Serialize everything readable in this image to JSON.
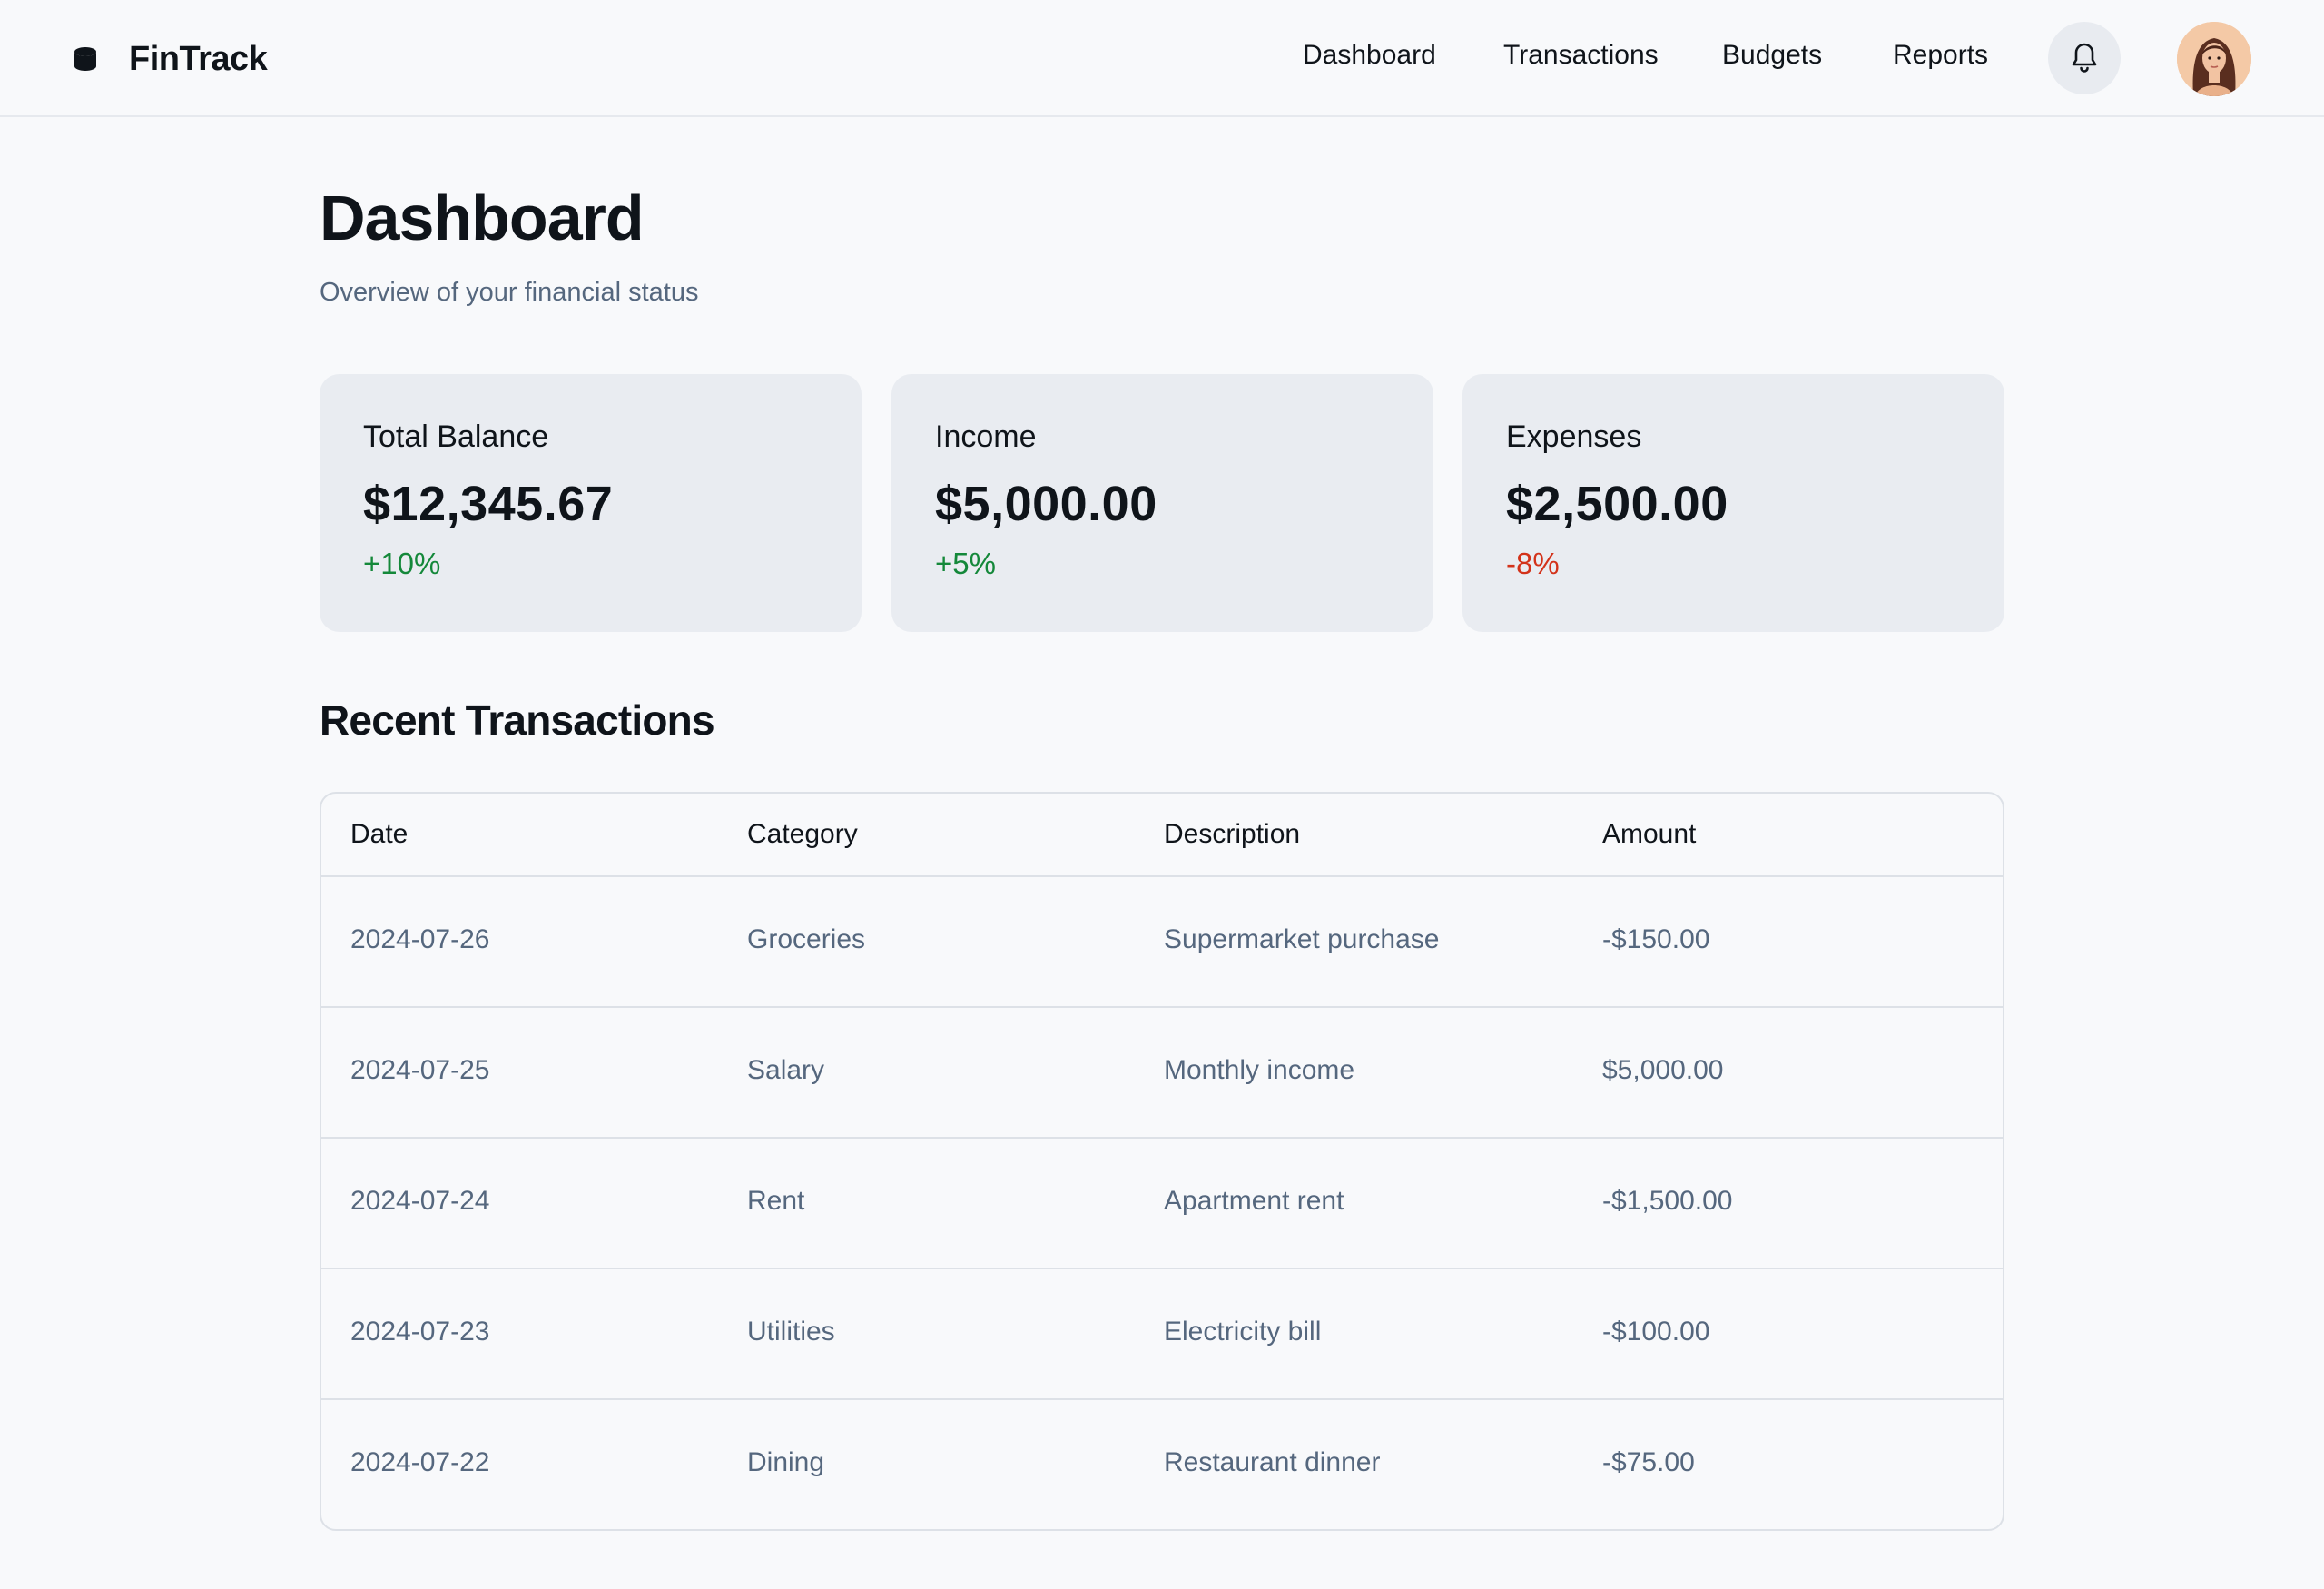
{
  "brand": {
    "name": "FinTrack",
    "icon": "database-icon"
  },
  "nav": {
    "links": [
      "Dashboard",
      "Transactions",
      "Budgets",
      "Reports"
    ],
    "bell_icon": "bell-icon",
    "avatar": "user-avatar"
  },
  "page": {
    "title": "Dashboard",
    "subtitle": "Overview of your financial status"
  },
  "cards": [
    {
      "label": "Total Balance",
      "value": "$12,345.67",
      "change": "+10%",
      "trend": "positive"
    },
    {
      "label": "Income",
      "value": "$5,000.00",
      "change": "+5%",
      "trend": "positive"
    },
    {
      "label": "Expenses",
      "value": "$2,500.00",
      "change": "-8%",
      "trend": "negative"
    }
  ],
  "transactions": {
    "title": "Recent Transactions",
    "columns": [
      "Date",
      "Category",
      "Description",
      "Amount"
    ],
    "rows": [
      [
        "2024-07-26",
        "Groceries",
        "Supermarket purchase",
        "-$150.00"
      ],
      [
        "2024-07-25",
        "Salary",
        "Monthly income",
        "$5,000.00"
      ],
      [
        "2024-07-24",
        "Rent",
        "Apartment rent",
        "-$1,500.00"
      ],
      [
        "2024-07-23",
        "Utilities",
        "Electricity bill",
        "-$100.00"
      ],
      [
        "2024-07-22",
        "Dining",
        "Restaurant dinner",
        "-$75.00"
      ]
    ]
  },
  "colors": {
    "positive": "#14883a",
    "negative": "#d3321a",
    "muted_text": "#55677e",
    "card_bg": "#e9ecf1"
  }
}
